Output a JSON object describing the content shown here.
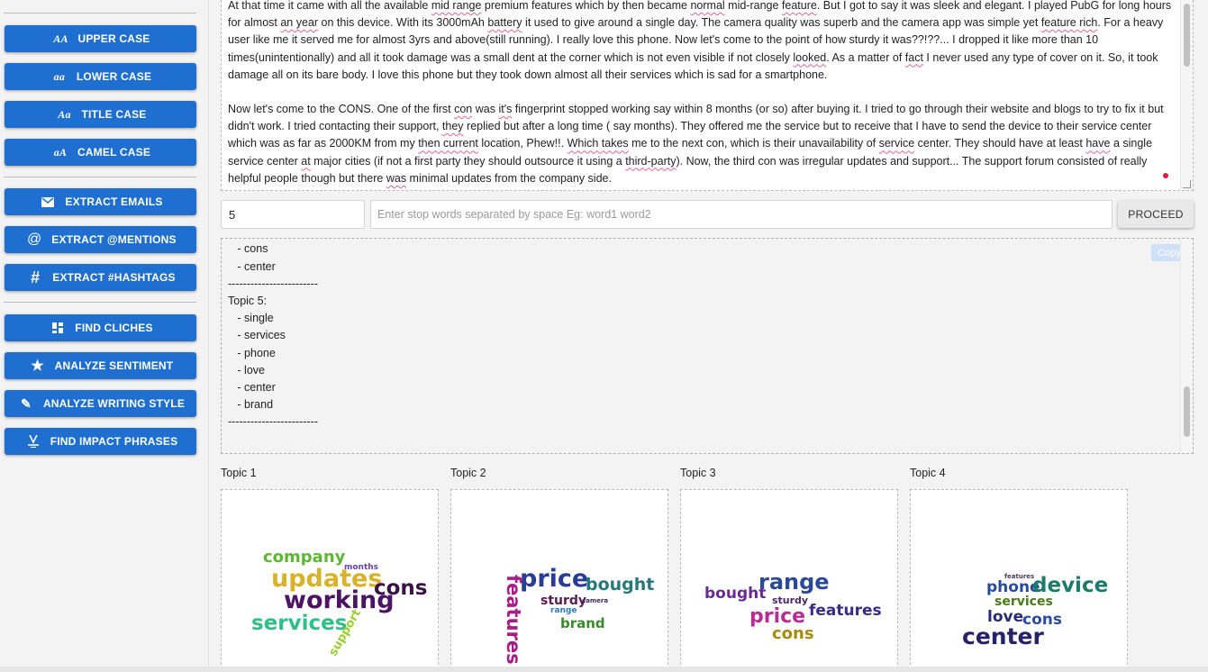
{
  "sidebar": {
    "case_buttons": [
      {
        "icon": "AA",
        "label": "UPPER CASE"
      },
      {
        "icon": "aa",
        "label": "LOWER CASE"
      },
      {
        "icon": "Aa",
        "label": "TITLE CASE"
      },
      {
        "icon": "aA",
        "label": "CAMEL CASE"
      }
    ],
    "extract_buttons": [
      {
        "icon": "envelope-icon",
        "label": "EXTRACT EMAILS"
      },
      {
        "icon": "at-icon",
        "label": "EXTRACT @MENTIONS"
      },
      {
        "icon": "hash-icon",
        "label": "EXTRACT #HASHTAGS"
      }
    ],
    "analyze_buttons": [
      {
        "icon": "dashboard-icon",
        "label": "FIND CLICHES"
      },
      {
        "icon": "star-icon",
        "label": "ANALYZE SENTIMENT"
      },
      {
        "icon": "pencil-icon",
        "label": "ANALYZE WRITING STYLE"
      },
      {
        "icon": "impact-icon",
        "label": "FIND IMPACT PHRASES"
      }
    ]
  },
  "editor": {
    "p1": [
      "At that time it came with all the available ",
      {
        "t": "mid range",
        "sq": true
      },
      " premium features which by then became ",
      {
        "t": "normal",
        "sq": true
      },
      " mid-range ",
      {
        "t": "feature",
        "sq": true
      },
      ". But I got to say it was sleek and elegant. I played PubG for long hours for almost ",
      {
        "t": "an year",
        "sq": true
      },
      " on this device. With its 3000mAh ",
      {
        "t": "battery",
        "sq": true
      },
      " it used to give around a single day. The camera quality was superb and the camera app was simple yet ",
      {
        "t": "feature rich",
        "sq": true
      },
      ". For a heavy user like me it served me for almost 3yrs and above(still running). I really love this phone. Now let's come to the point of how sturdy it was??!??... I dropped it like more than 10 times(unintentionally) and all it took damage was a small dent at the corner which is not even visible if not closely ",
      {
        "t": "looked",
        "sq": true
      },
      ". As a matter of ",
      {
        "t": "fact",
        "sq": true
      },
      " I never used any type of cover on it. So, it took damage all on its bare body. I love this phone but they took down almost all their services which is sad for a smartphone."
    ],
    "p2": [
      "Now let's come to the CONS. One of the first ",
      {
        "t": "con",
        "sq": true
      },
      " was ",
      {
        "t": "it's",
        "sq": true
      },
      " fingerprint stopped working say within 8 months (or so) after buying it. I tried to go through their website and blogs to try to fix it but didn't work. I tried contacting their support, ",
      {
        "t": "they",
        "sq": true
      },
      " replied but after a long time ( say months). They offered me the service but to receive that I have to send the device to their service center which was as far as 2000KM from my ",
      {
        "t": "then current",
        "sq": true
      },
      " location, Phew!!. ",
      {
        "t": "Which takes",
        "sq": true
      },
      " me to the next con, which is their unavailability of ",
      {
        "t": "service",
        "sq": true
      },
      " center. They should have at least ",
      {
        "t": "have",
        "sq": true
      },
      " a single service center ",
      {
        "t": "at",
        "sq": true
      },
      " major cities (if not a first party they should outsource it using a ",
      {
        "t": "third-party",
        "sq": true
      },
      "). Now, the third con was irregular updates and support... The support forum consisted of really helpful people though but there ",
      {
        "t": "was",
        "sq": true
      },
      " minimal updates from the company side."
    ]
  },
  "controls": {
    "topic_count": "5",
    "stopwords_placeholder": "Enter stop words separated by space Eg: word1 word2",
    "proceed_label": "PROCEED"
  },
  "output": {
    "copy_label": "Copy",
    "lines": [
      "   - cons",
      "   - center",
      "------------------------",
      "Topic 5:",
      "   - single",
      "   - services",
      "   - phone",
      "   - love",
      "   - center",
      "   - brand",
      "------------------------"
    ]
  },
  "topics": [
    {
      "label": "Topic 1",
      "words": [
        {
          "text": "company",
          "color": "#5cb82e"
        },
        {
          "text": "months",
          "color": "#6a3fb5"
        },
        {
          "text": "updates",
          "color": "#d8b22a"
        },
        {
          "text": "cons",
          "color": "#3a1248"
        },
        {
          "text": "working",
          "color": "#4b1464"
        },
        {
          "text": "services",
          "color": "#2fc08a"
        },
        {
          "text": "support",
          "color": "#9ad02e"
        }
      ]
    },
    {
      "label": "Topic 2",
      "words": [
        {
          "text": "price",
          "color": "#2a3d96"
        },
        {
          "text": "bought",
          "color": "#26787a"
        },
        {
          "text": "features",
          "color": "#a81d86"
        },
        {
          "text": "sturdy",
          "color": "#5a1a55"
        },
        {
          "text": "camera",
          "color": "#3a2a6a"
        },
        {
          "text": "range",
          "color": "#2a7ac8"
        },
        {
          "text": "brand",
          "color": "#3a8a2c"
        }
      ]
    },
    {
      "label": "Topic 3",
      "words": [
        {
          "text": "range",
          "color": "#2a4a96"
        },
        {
          "text": "bought",
          "color": "#6a2a96"
        },
        {
          "text": "sturdy",
          "color": "#4a2a6a"
        },
        {
          "text": "price",
          "color": "#b82c98"
        },
        {
          "text": "features",
          "color": "#3a2a8a"
        },
        {
          "text": "cons",
          "color": "#a68a14"
        }
      ]
    },
    {
      "label": "Topic 4",
      "words": [
        {
          "text": "features",
          "color": "#4a3a5a"
        },
        {
          "text": "phone",
          "color": "#2a4a9a"
        },
        {
          "text": "device",
          "color": "#1e7a6a"
        },
        {
          "text": "services",
          "color": "#4a7a1a"
        },
        {
          "text": "love",
          "color": "#2a2a7a"
        },
        {
          "text": "cons",
          "color": "#2a4aa6"
        },
        {
          "text": "center",
          "color": "#26226a"
        }
      ]
    }
  ]
}
